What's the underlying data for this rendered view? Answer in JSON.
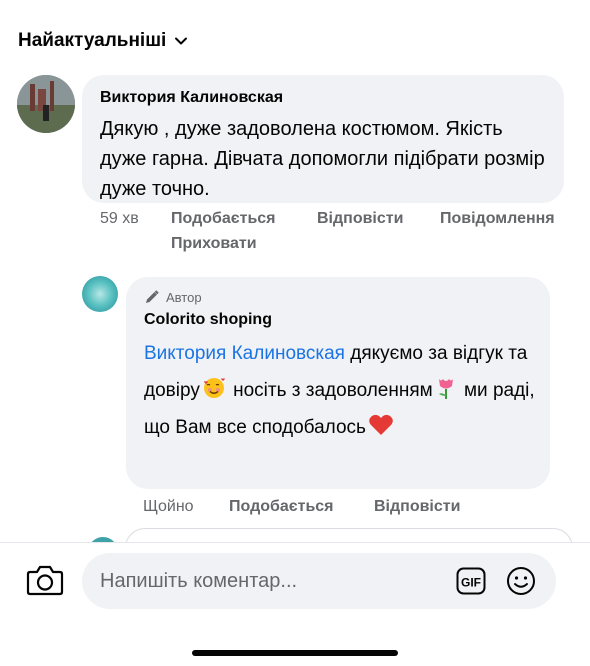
{
  "sort": {
    "label": "Найактуальніші"
  },
  "comment1": {
    "author": "Виктория Калиновская",
    "text": "Дякую , дуже задоволена костюмом. Якість дуже гарна. Дівчата допомогли підібрати розмір дуже точно.",
    "time": "59 хв",
    "like": "Подобається",
    "reply": "Відповісти",
    "report": "Повідомлення",
    "hide": "Приховати"
  },
  "reply1": {
    "badge": "Автор",
    "author": "Colorito shoping",
    "mention": "Виктория Калиновская",
    "text_a": " дякуємо за відгук та довіру",
    "text_b": " носіть з задоволенням",
    "text_c": " ми раді, що Вам все сподобалось",
    "time": "Щойно",
    "like": "Подобається",
    "reply": "Відповісти"
  },
  "composer": {
    "placeholder": "Напишіть коментар..."
  },
  "icons": [
    "chevron-down-icon",
    "pencil-icon",
    "smiling-hearts-emoji",
    "tulip-emoji",
    "red-heart-emoji",
    "camera-icon",
    "gif-icon",
    "smile-icon"
  ],
  "colors": {
    "mention": "#1b74e4",
    "meta": "#65676b",
    "bubble": "#f0f2f5"
  }
}
